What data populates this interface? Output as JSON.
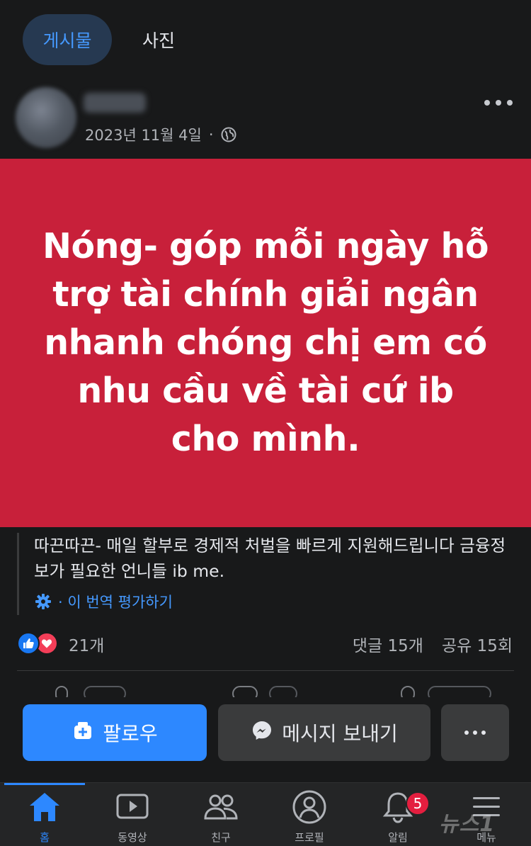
{
  "tabs": {
    "posts": "게시물",
    "photos": "사진"
  },
  "post": {
    "date": "2023년 11월 4일",
    "separator": "·",
    "banner_text": "Nóng- góp mỗi ngày hỗ trợ tài chính giải ngân nhanh chóng chị em có nhu cầu về tài cứ ib cho mình.",
    "caption": "따끈따끈- 매일 할부로 경제적 처벌을 빠르게 지원해드립니다 금융정보가 필요한 언니들 ib me.",
    "translate_rate": "· 이 번역 평가하기",
    "reaction_count": "21개",
    "comments": "댓글 15개",
    "shares": "공유 15회"
  },
  "actions": {
    "follow": "팔로우",
    "message": "메시지 보내기"
  },
  "nav": {
    "home": "홈",
    "video": "동영상",
    "friends": "친구",
    "profile": "프로필",
    "notifications": "알림",
    "notification_badge": "5",
    "menu": "메뉴"
  },
  "watermark": "뉴스1",
  "colors": {
    "background": "#18191a",
    "banner": "#c8203a",
    "accent": "#2d88ff",
    "badge": "#e41e3f"
  }
}
